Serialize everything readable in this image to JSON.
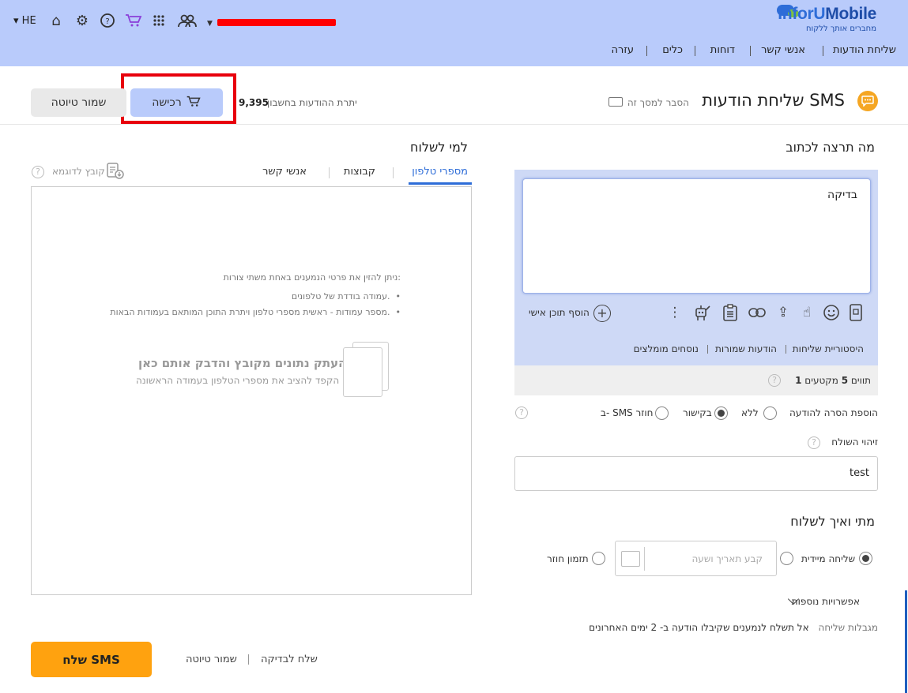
{
  "header": {
    "language": "HE",
    "logo": {
      "brand_a": "InforU",
      "brand_b": "Mobile",
      "tagline": "מחברים אותך ללקוח"
    },
    "nav": [
      "שליחת הודעות",
      "אנשי קשר",
      "דוחות",
      "כלים",
      "עזרה"
    ],
    "icons": [
      "caret-down-icon",
      "home-icon",
      "gear-icon",
      "help-bubble-icon",
      "cart-icon",
      "apps-grid-icon",
      "contacts-icon"
    ]
  },
  "page": {
    "title": "שליחת הודעות SMS",
    "explain": "הסבר למסך זה",
    "balance_label": "יתרת ההודעות בחשבון",
    "balance_value": "9,395",
    "buy_label": "רכישה",
    "save_draft_label": "שמור טיוטה"
  },
  "compose": {
    "heading": "מה תרצה לכתוב",
    "message": "בדיקה",
    "add_personal": "הוסף תוכן אישי",
    "links": [
      "היסטוריית שליחות",
      "הודעות שמורות",
      "נוסחים מומלצים"
    ],
    "counter_prefix": "תווים",
    "chars": "5",
    "segments_label": "מקטעים",
    "segments": "1",
    "removal_label": "הוספת הסרה להודעה",
    "removal_options": [
      "ללא",
      "בקישור",
      "ב- SMS חוזר"
    ],
    "removal_selected": "בקישור",
    "sender_label": "זיהוי השולח",
    "sender_value": "test"
  },
  "schedule": {
    "heading": "מתי ואיך לשלוח",
    "immediate": "שליחה מיידית",
    "date_placeholder": "קבע תאריך ושעה",
    "recurring": "תזמון חוזר",
    "more_options": "אפשרויות נוספות",
    "limits_label": "מגבלות שליחה",
    "limits_text": "אל תשלח לנמענים שקיבלו הודעה ב- 2 ימים האחרונים"
  },
  "recipients": {
    "heading": "למי לשלוח",
    "tabs": [
      "מספרי טלפון",
      "קבוצות",
      "אנשי קשר"
    ],
    "sample_file": "קובץ לדוגמא",
    "instr_title": "ניתן להזין את פרטי הנמענים באחת משתי צורות:",
    "instr_1": "עמודה בודדת של טלפונים.",
    "instr_2": "מספר עמודות - ראשית מספרי טלפון ויתרת התוכן המותאם בעמודות הבאות.",
    "drop_title": "העתק נתונים מקובץ והדבק אותם כאן",
    "drop_sub": "הקפד להציב את מספרי הטלפון בעמודה הראשונה"
  },
  "footer": {
    "send_label": "שלח SMS",
    "save_draft": "שמור טיוטה",
    "send_test": "שלח לבדיקה"
  },
  "colors": {
    "header_bg": "#b9cbfb",
    "accent": "#2e6dd8",
    "send_btn": "#ffa20f",
    "highlight": "#e8000c"
  }
}
